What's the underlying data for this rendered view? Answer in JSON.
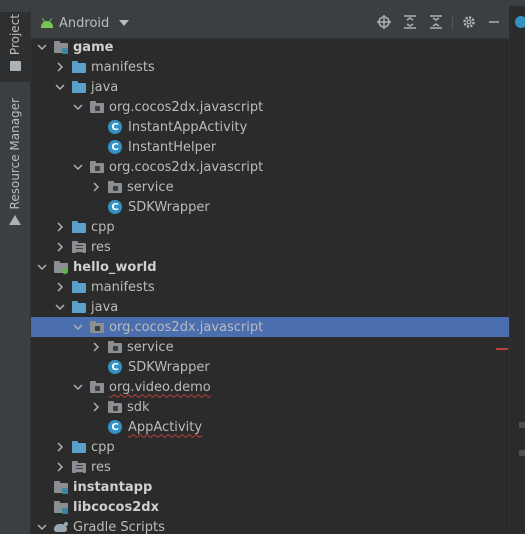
{
  "left_strip": {
    "project_tab": "Project",
    "resource_tab": "Resource Manager"
  },
  "toolbar": {
    "view_selector": "Android",
    "icons": [
      "locate-icon",
      "expand-all-icon",
      "collapse-all-icon",
      "gear-icon",
      "hide-icon"
    ]
  },
  "tree": {
    "rows": [
      {
        "label": "game",
        "arrow": "expanded",
        "icon": "module-folder",
        "indent": 0,
        "bold": true
      },
      {
        "label": "manifests",
        "arrow": "collapsed",
        "icon": "folder-blue",
        "indent": 1
      },
      {
        "label": "java",
        "arrow": "expanded",
        "icon": "folder-blue",
        "indent": 1
      },
      {
        "label": "org.cocos2dx.javascript",
        "arrow": "expanded",
        "icon": "package",
        "indent": 2
      },
      {
        "label": "InstantAppActivity",
        "arrow": "none",
        "icon": "class",
        "indent": 3
      },
      {
        "label": "InstantHelper",
        "arrow": "none",
        "icon": "class",
        "indent": 3
      },
      {
        "label": "org.cocos2dx.javascript",
        "arrow": "expanded",
        "icon": "package",
        "indent": 2
      },
      {
        "label": "service",
        "arrow": "collapsed",
        "icon": "package",
        "indent": 3
      },
      {
        "label": "SDKWrapper",
        "arrow": "none",
        "icon": "class",
        "indent": 3
      },
      {
        "label": "cpp",
        "arrow": "collapsed",
        "icon": "folder-blue",
        "indent": 1
      },
      {
        "label": "res",
        "arrow": "collapsed",
        "icon": "res-folder",
        "indent": 1
      },
      {
        "label": "hello_world",
        "arrow": "expanded",
        "icon": "app-module-folder",
        "indent": 0,
        "bold": true
      },
      {
        "label": "manifests",
        "arrow": "collapsed",
        "icon": "folder-blue",
        "indent": 1
      },
      {
        "label": "java",
        "arrow": "expanded",
        "icon": "folder-blue",
        "indent": 1
      },
      {
        "label": "org.cocos2dx.javascript",
        "arrow": "expanded",
        "icon": "package",
        "indent": 2,
        "selected": true
      },
      {
        "label": "service",
        "arrow": "collapsed",
        "icon": "package",
        "indent": 3
      },
      {
        "label": "SDKWrapper",
        "arrow": "none",
        "icon": "class",
        "indent": 3
      },
      {
        "label": "org.video.demo",
        "arrow": "expanded",
        "icon": "package",
        "indent": 2,
        "squiggle": true
      },
      {
        "label": "sdk",
        "arrow": "collapsed",
        "icon": "package",
        "indent": 3
      },
      {
        "label": "AppActivity",
        "arrow": "none",
        "icon": "class",
        "indent": 3,
        "squiggle": true
      },
      {
        "label": "cpp",
        "arrow": "collapsed",
        "icon": "folder-blue",
        "indent": 1
      },
      {
        "label": "res",
        "arrow": "collapsed",
        "icon": "res-folder",
        "indent": 1
      },
      {
        "label": "instantapp",
        "arrow": "none",
        "icon": "module-folder",
        "indent": 0,
        "bold": true
      },
      {
        "label": "libcocos2dx",
        "arrow": "none",
        "icon": "module-folder",
        "indent": 0,
        "bold": true
      },
      {
        "label": "Gradle Scripts",
        "arrow": "expanded",
        "icon": "gradle",
        "indent": 0
      }
    ]
  },
  "colors": {
    "selection": "#4b6eaf",
    "error": "#bc3f3c",
    "class_icon": "#3592c4",
    "folder": "#5aa0c8"
  }
}
